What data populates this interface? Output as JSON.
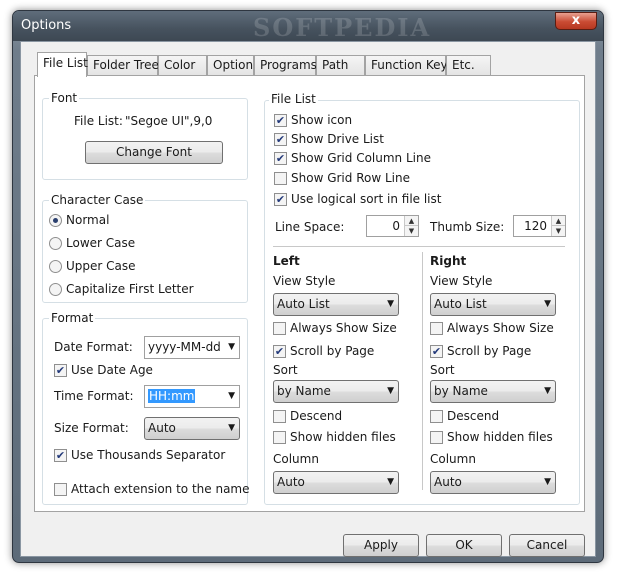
{
  "window": {
    "title": "Options",
    "watermark": "SOFTPEDIA",
    "close_label": "x"
  },
  "tabs": [
    {
      "label": "File List",
      "active": true
    },
    {
      "label": "Folder Tree"
    },
    {
      "label": "Color"
    },
    {
      "label": "Option"
    },
    {
      "label": "Programs"
    },
    {
      "label": "Path"
    },
    {
      "label": "Function Key"
    },
    {
      "label": "Etc."
    }
  ],
  "font_group": {
    "title": "Font",
    "file_list_label": "File List:",
    "file_list_value": "\"Segoe UI\",9,0",
    "change_font_label": "Change Font"
  },
  "character_case": {
    "title": "Character Case",
    "options": [
      {
        "label": "Normal",
        "selected": true
      },
      {
        "label": "Lower Case"
      },
      {
        "label": "Upper Case"
      },
      {
        "label": "Capitalize First Letter"
      }
    ]
  },
  "format": {
    "title": "Format",
    "date_format_label": "Date Format:",
    "date_format_value": "yyyy-MM-dd",
    "use_date_age_label": "Use Date Age",
    "use_date_age_checked": true,
    "time_format_label": "Time Format:",
    "time_format_value": "HH:mm",
    "size_format_label": "Size Format:",
    "size_format_value": "Auto",
    "thousands_sep_label": "Use Thousands Separator",
    "thousands_sep_checked": true,
    "attach_ext_label": "Attach extension to the name",
    "attach_ext_checked": false
  },
  "file_list": {
    "title": "File List",
    "options": [
      {
        "label": "Show icon",
        "checked": true
      },
      {
        "label": "Show Drive List",
        "checked": true
      },
      {
        "label": "Show Grid Column Line",
        "checked": true
      },
      {
        "label": "Show Grid Row Line",
        "checked": false
      },
      {
        "label": "Use logical sort in file list",
        "checked": true
      }
    ],
    "line_space_label": "Line Space:",
    "line_space_value": "0",
    "thumb_size_label": "Thumb Size:",
    "thumb_size_value": "120"
  },
  "left": {
    "title": "Left",
    "view_style_label": "View Style",
    "view_style_value": "Auto List",
    "always_show_size_label": "Always Show Size",
    "always_show_size_checked": false,
    "scroll_by_page_label": "Scroll by Page",
    "scroll_by_page_checked": true,
    "sort_label": "Sort",
    "sort_value": "by Name",
    "descend_label": "Descend",
    "descend_checked": false,
    "show_hidden_label": "Show hidden files",
    "show_hidden_checked": false,
    "column_label": "Column",
    "column_value": "Auto"
  },
  "right": {
    "title": "Right",
    "view_style_label": "View Style",
    "view_style_value": "Auto List",
    "always_show_size_label": "Always Show Size",
    "always_show_size_checked": false,
    "scroll_by_page_label": "Scroll by Page",
    "scroll_by_page_checked": true,
    "sort_label": "Sort",
    "sort_value": "by Name",
    "descend_label": "Descend",
    "descend_checked": false,
    "show_hidden_label": "Show hidden files",
    "show_hidden_checked": false,
    "column_label": "Column",
    "column_value": "Auto"
  },
  "buttons": {
    "apply": "Apply",
    "ok": "OK",
    "cancel": "Cancel"
  },
  "colors": {
    "titlebar": "#46525e",
    "close_button": "#c94b33",
    "selection": "#3399ff"
  }
}
